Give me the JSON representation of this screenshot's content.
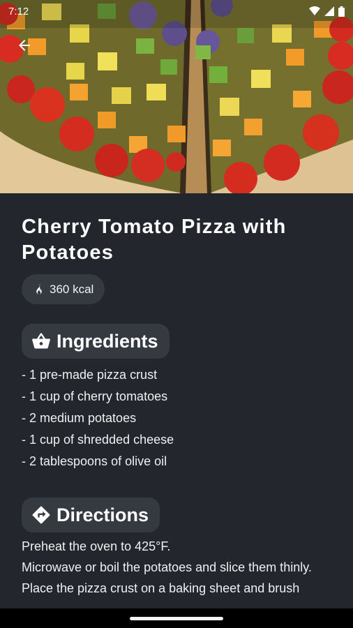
{
  "status_bar": {
    "time": "7:12"
  },
  "recipe": {
    "title": "Cherry Tomato Pizza with Potatoes",
    "calories": "360 kcal"
  },
  "ingredients": {
    "heading": "Ingredients",
    "items": [
      "- 1 pre-made pizza crust",
      "- 1 cup of cherry tomatoes",
      "- 2 medium potatoes",
      "- 1 cup of shredded cheese",
      "- 2 tablespoons of olive oil"
    ]
  },
  "directions": {
    "heading": "Directions",
    "steps": [
      "Preheat the oven to 425°F.",
      "Microwave or boil the potatoes and slice them thinly.",
      "Place the pizza crust on a baking sheet and brush"
    ]
  },
  "icons": {
    "back": "arrow-back-icon",
    "calories": "flame-icon",
    "ingredients": "basket-icon",
    "directions": "directions-sign-icon"
  },
  "colors": {
    "background": "#23272d",
    "chip": "#353a41",
    "text": "#f1f3f4"
  }
}
